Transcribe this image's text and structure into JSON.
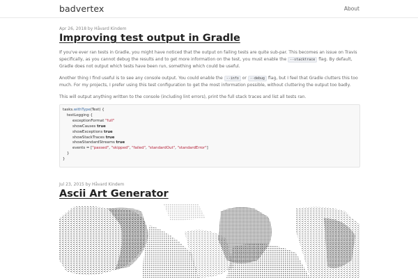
{
  "site": {
    "title": "badvertex",
    "nav_about": "About"
  },
  "posts": [
    {
      "meta": "Apr 26, 2018 by Håvard Kindem",
      "title": "Improving test output in Gradle",
      "p1": "If you've ever ran tests in Gradle, you might have noticed that the output on failing tests are quite sub-par. This becomes an issue on Travis specifically, as you cannot debug the results and to get more information on the test, you must enable the",
      "p1_code": "--stacktrace",
      "p1_end": "flag. By default, Gradle does not output which tests have been run, something which could be useful.",
      "p2_start": "Another thing I find useful is to see any console output. You could enable the",
      "p2_code1": "--info",
      "p2_or": "or",
      "p2_code2": "--debug",
      "p2_end": "flag, but I feel that Gradle clutters this too much. For my projects, I prefer using this test configuration to get the most information possible, without cluttering the output too badly.",
      "p3": "This will output anything written to the console (including lint errors), print the full stack traces and list all tests ran.",
      "code": {
        "l1_a": "tasks.",
        "l1_fn": "withType",
        "l1_b": "(Test) {",
        "l2": "testLogging {",
        "l3_a": "exceptionFormat ",
        "l3_s": "\"full\"",
        "l4_a": "showCauses ",
        "l4_b": "true",
        "l5_a": "showExceptions ",
        "l5_b": "true",
        "l6_a": "showStackTraces ",
        "l6_b": "true",
        "l7_a": "showStandardStreams ",
        "l7_b": "true",
        "l8_a": "events = [",
        "l8_s1": "\"passed\"",
        "l8_c1": ", ",
        "l8_s2": "\"skipped\"",
        "l8_c2": ", ",
        "l8_s3": "\"failed\"",
        "l8_c3": ", ",
        "l8_s4": "\"standardOut\"",
        "l8_c4": ", ",
        "l8_s5": "\"standardError\"",
        "l8_b": "]",
        "l9": "}",
        "l10": "}"
      }
    },
    {
      "meta": "Jul 23, 2015 by Håvard Kindem",
      "title": "Ascii Art Generator"
    }
  ],
  "ascii_art_icon": "ascii-art-image"
}
